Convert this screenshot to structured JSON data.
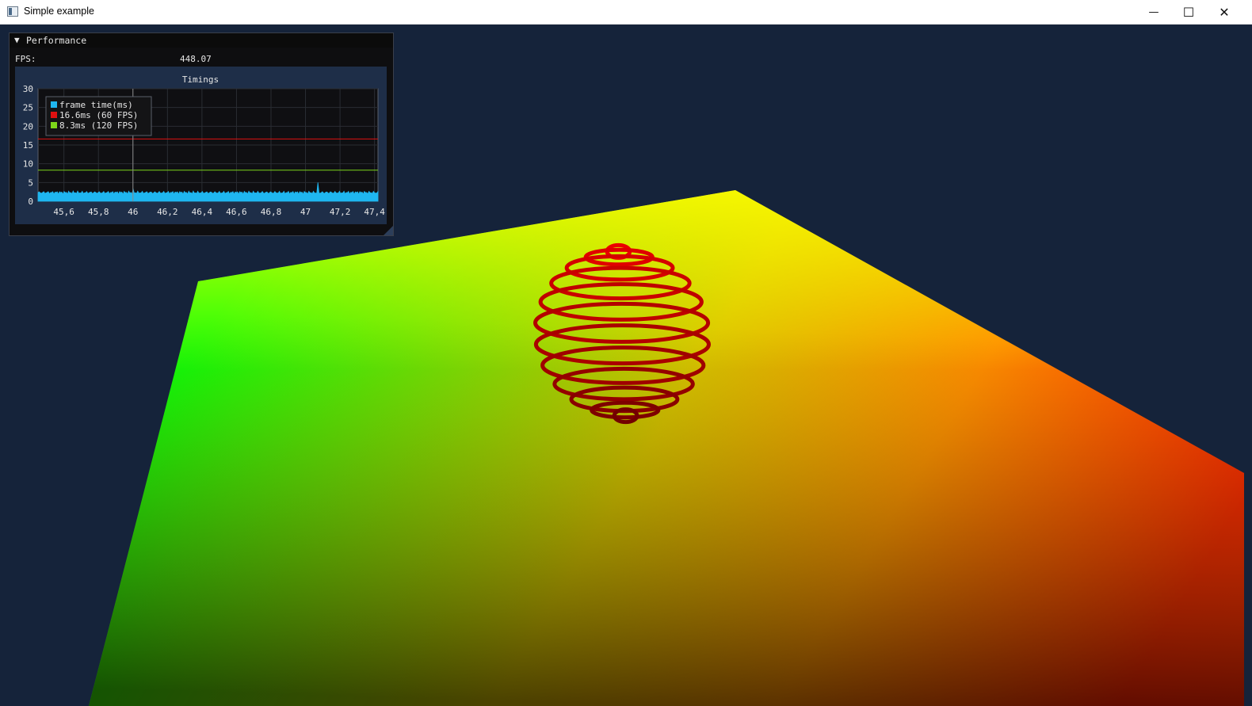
{
  "window": {
    "title": "Simple example",
    "minimize_glyph": "—",
    "maximize_glyph": "☐",
    "close_glyph": "✕"
  },
  "performance_panel": {
    "collapse_glyph": "▼",
    "title": "Performance",
    "fps_label": "FPS:",
    "fps_value": "448.07"
  },
  "colors": {
    "background": "#15233a",
    "frame_time": "#1fb6f0",
    "target_60": "#e01010",
    "target_120": "#7cd61a"
  },
  "chart_data": {
    "type": "area",
    "title": "Timings",
    "xlim": [
      45.45,
      47.42
    ],
    "ylim": [
      0,
      30
    ],
    "x_ticks": [
      "45,6",
      "45,8",
      "46",
      "46,2",
      "46,4",
      "46,6",
      "46,8",
      "47",
      "47,2",
      "47,4"
    ],
    "x_tick_values": [
      45.6,
      45.8,
      46.0,
      46.2,
      46.4,
      46.6,
      46.8,
      47.0,
      47.2,
      47.4
    ],
    "y_ticks": [
      "30",
      "25",
      "20",
      "15",
      "10",
      "5",
      "0"
    ],
    "y_tick_values": [
      30,
      25,
      20,
      15,
      10,
      5,
      0
    ],
    "legend_position": "top-left",
    "series": [
      {
        "name": "frame time(ms)",
        "kind": "area",
        "typical_value": 2.3,
        "spikes": [
          [
            46.0,
            3.2
          ],
          [
            47.07,
            5.0
          ]
        ]
      },
      {
        "name": "16.6ms (60 FPS)",
        "kind": "hline",
        "value": 16.6
      },
      {
        "name": " 8.3ms (120 FPS)",
        "kind": "hline",
        "value": 8.3
      }
    ],
    "cursor_x": 46.0
  }
}
